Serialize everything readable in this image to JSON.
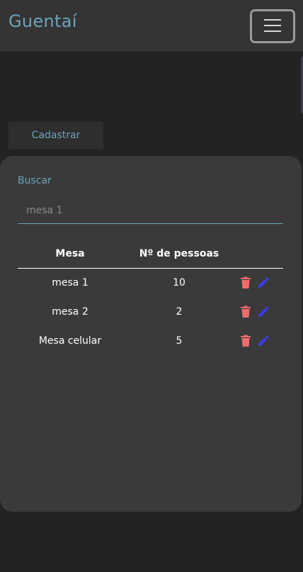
{
  "navbar": {
    "brand": "Guentaí"
  },
  "actions": {
    "cadastrar_label": "Cadastrar"
  },
  "search": {
    "label": "Buscar",
    "placeholder": "mesa 1",
    "value": ""
  },
  "table": {
    "headers": [
      "Mesa",
      "Nº de pessoas",
      ""
    ],
    "rows": [
      {
        "mesa": "mesa 1",
        "pessoas": "10"
      },
      {
        "mesa": "mesa 2",
        "pessoas": "2"
      },
      {
        "mesa": "Mesa celular",
        "pessoas": "5"
      }
    ]
  },
  "icons": {
    "delete": "trash-icon",
    "edit": "pencil-icon"
  },
  "colors": {
    "accent": "#6ba3b8",
    "delete": "#f06b6b",
    "edit": "#3b3bf0"
  }
}
